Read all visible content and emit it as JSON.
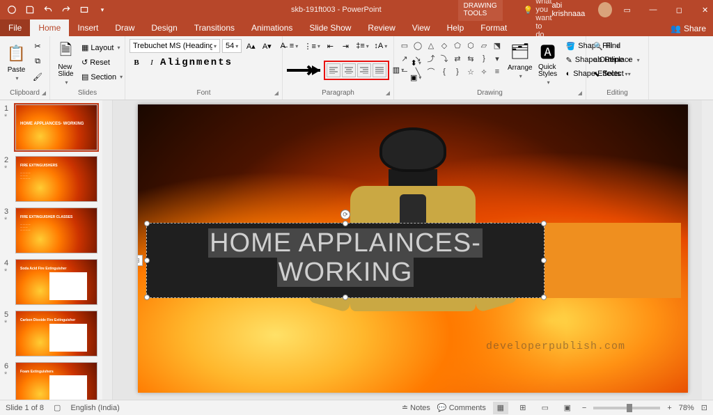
{
  "app": {
    "doc_title": "skb-191ft003 - PowerPoint",
    "context_title": "DRAWING TOOLS",
    "user": "abi krishnaaa",
    "tell_me": "Tell me what you want to do"
  },
  "tabs": {
    "file": "File",
    "home": "Home",
    "insert": "Insert",
    "draw": "Draw",
    "design": "Design",
    "transitions": "Transitions",
    "animations": "Animations",
    "slideshow": "Slide Show",
    "review": "Review",
    "view": "View",
    "help": "Help",
    "format": "Format",
    "share": "Share"
  },
  "ribbon": {
    "clipboard": {
      "label": "Clipboard",
      "paste": "Paste"
    },
    "slides": {
      "label": "Slides",
      "new": "New\nSlide",
      "layout": "Layout",
      "reset": "Reset",
      "section": "Section"
    },
    "font": {
      "label": "Font",
      "name": "Trebuchet MS (Headings)",
      "size": "54",
      "annotation": "Alignments"
    },
    "paragraph": {
      "label": "Paragraph"
    },
    "drawing": {
      "label": "Drawing",
      "arrange": "Arrange",
      "quick": "Quick\nStyles",
      "fill": "Shape Fill",
      "outline": "Shape Outline",
      "effects": "Shape Effects"
    },
    "editing": {
      "label": "Editing",
      "find": "Find",
      "replace": "Replace",
      "select": "Select"
    }
  },
  "thumbnails": [
    {
      "n": "1",
      "title": "HOME APPLIANCES- WORKING"
    },
    {
      "n": "2",
      "title": "FIRE EXTINGUISHERS"
    },
    {
      "n": "3",
      "title": "FIRE EXTINGUISHER CLASSES"
    },
    {
      "n": "4",
      "title": "Soda Acid Fire Extinguisher"
    },
    {
      "n": "5",
      "title": "Carbon Dioxide Fire Extinguisher"
    },
    {
      "n": "6",
      "title": "Foam Extinguishers"
    }
  ],
  "slide": {
    "title_line1": "HOME APPLAINCES-",
    "title_line2": "WORKING",
    "watermark": "developerpublish.com"
  },
  "status": {
    "slide": "Slide 1 of 8",
    "lang": "English (India)",
    "notes": "Notes",
    "comments": "Comments",
    "zoom": "78%"
  }
}
